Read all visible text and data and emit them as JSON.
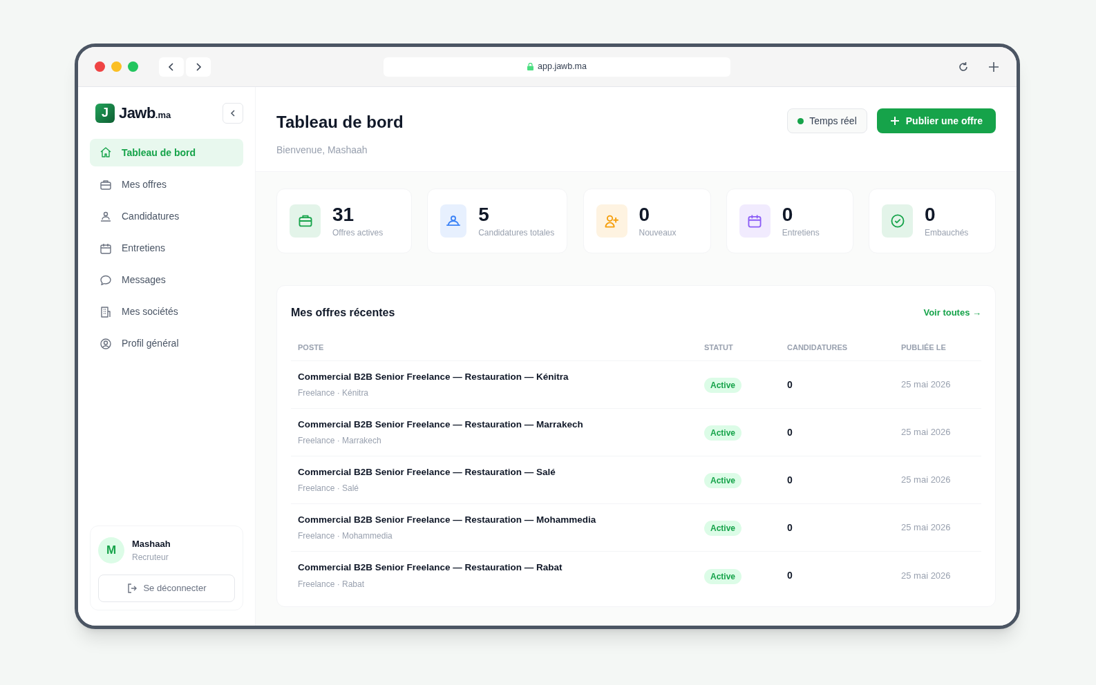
{
  "browser": {
    "url": "app.jawb.ma"
  },
  "brand": {
    "name": "Jawb",
    "suffix": ".ma",
    "mark": "J"
  },
  "sidebar": {
    "items": [
      {
        "label": "Tableau de bord",
        "selected": true
      },
      {
        "label": "Mes offres",
        "selected": false
      },
      {
        "label": "Candidatures",
        "selected": false
      },
      {
        "label": "Entretiens",
        "selected": false
      },
      {
        "label": "Messages",
        "selected": false
      },
      {
        "label": "Mes sociétés",
        "selected": false
      },
      {
        "label": "Profil général",
        "selected": false
      }
    ]
  },
  "user": {
    "initial": "M",
    "name": "Mashaah",
    "role": "Recruteur",
    "logout": "Se déconnecter"
  },
  "header": {
    "title": "Tableau de bord",
    "subtitle": "Bienvenue, Mashaah",
    "live": "Temps réel",
    "publish": "Publier une offre"
  },
  "stats": [
    {
      "value": "31",
      "label": "Offres actives",
      "color": "#16a34a"
    },
    {
      "value": "5",
      "label": "Candidatures totales",
      "color": "#3b82f6"
    },
    {
      "value": "0",
      "label": "Nouveaux",
      "color": "#f59e0b"
    },
    {
      "value": "0",
      "label": "Entretiens",
      "color": "#8b5cf6"
    },
    {
      "value": "0",
      "label": "Embauchés",
      "color": "#16a34a"
    }
  ],
  "recent": {
    "title": "Mes offres récentes",
    "link": "Voir toutes →",
    "columns": [
      "POSTE",
      "STATUT",
      "CANDIDATURES",
      "PUBLIÉE LE"
    ],
    "rows": [
      {
        "title": "Commercial B2B Senior Freelance — Restauration — Kénitra",
        "meta": "Freelance · Kénitra",
        "status": "Active",
        "count": "0",
        "date": "25 mai 2026"
      },
      {
        "title": "Commercial B2B Senior Freelance — Restauration — Marrakech",
        "meta": "Freelance · Marrakech",
        "status": "Active",
        "count": "0",
        "date": "25 mai 2026"
      },
      {
        "title": "Commercial B2B Senior Freelance — Restauration — Salé",
        "meta": "Freelance · Salé",
        "status": "Active",
        "count": "0",
        "date": "25 mai 2026"
      },
      {
        "title": "Commercial B2B Senior Freelance — Restauration — Mohammedia",
        "meta": "Freelance · Mohammedia",
        "status": "Active",
        "count": "0",
        "date": "25 mai 2026"
      },
      {
        "title": "Commercial B2B Senior Freelance — Restauration — Rabat",
        "meta": "Freelance · Rabat",
        "status": "Active",
        "count": "0",
        "date": "25 mai 2026"
      }
    ]
  }
}
